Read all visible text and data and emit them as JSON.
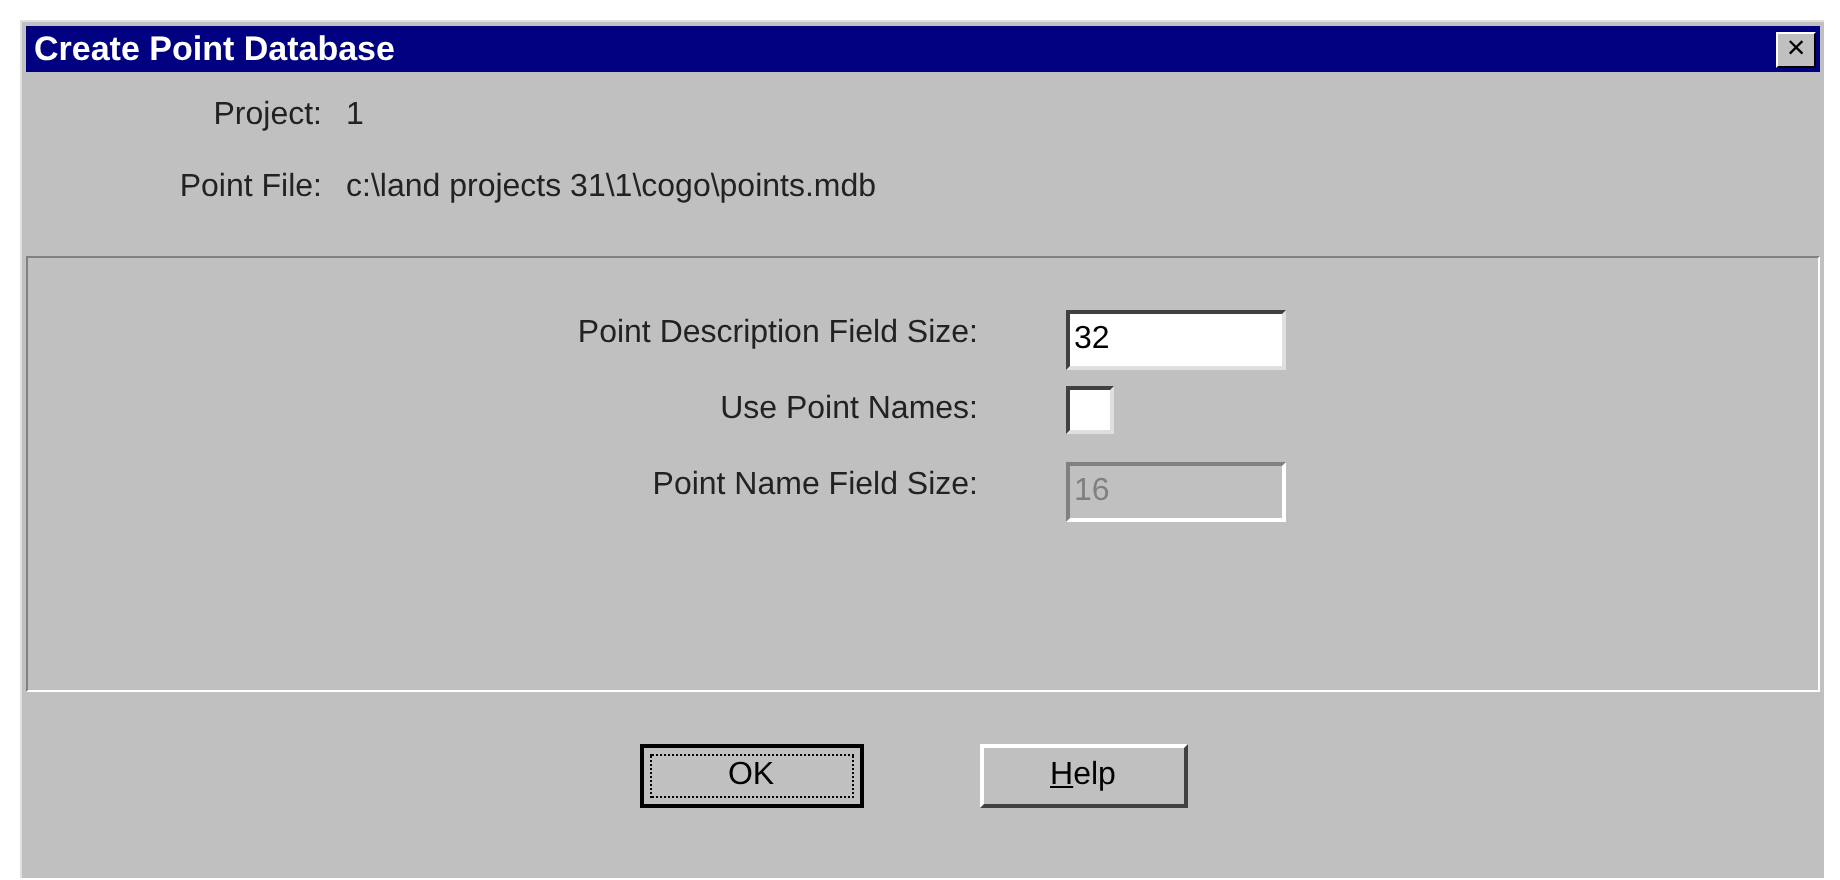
{
  "window": {
    "title": "Create Point Database",
    "close": "×"
  },
  "info": [
    {
      "label": "Project:",
      "value": "1"
    },
    {
      "label": "Point File:",
      "value": "c:\\land projects 31\\1\\cogo\\points.mdb"
    }
  ],
  "options": [
    {
      "kind": "text",
      "label": "Point Description Field Size:",
      "value": "32",
      "disabled": false
    },
    {
      "kind": "checkbox",
      "label": "Use Point Names:",
      "checked": false
    },
    {
      "kind": "text",
      "label": "Point Name Field Size:",
      "value": "16",
      "disabled": true
    }
  ],
  "buttons": [
    {
      "label": "OK",
      "focused": true,
      "mnemonic": false
    },
    {
      "label": "Help",
      "focused": false,
      "mnemonic": true
    }
  ]
}
